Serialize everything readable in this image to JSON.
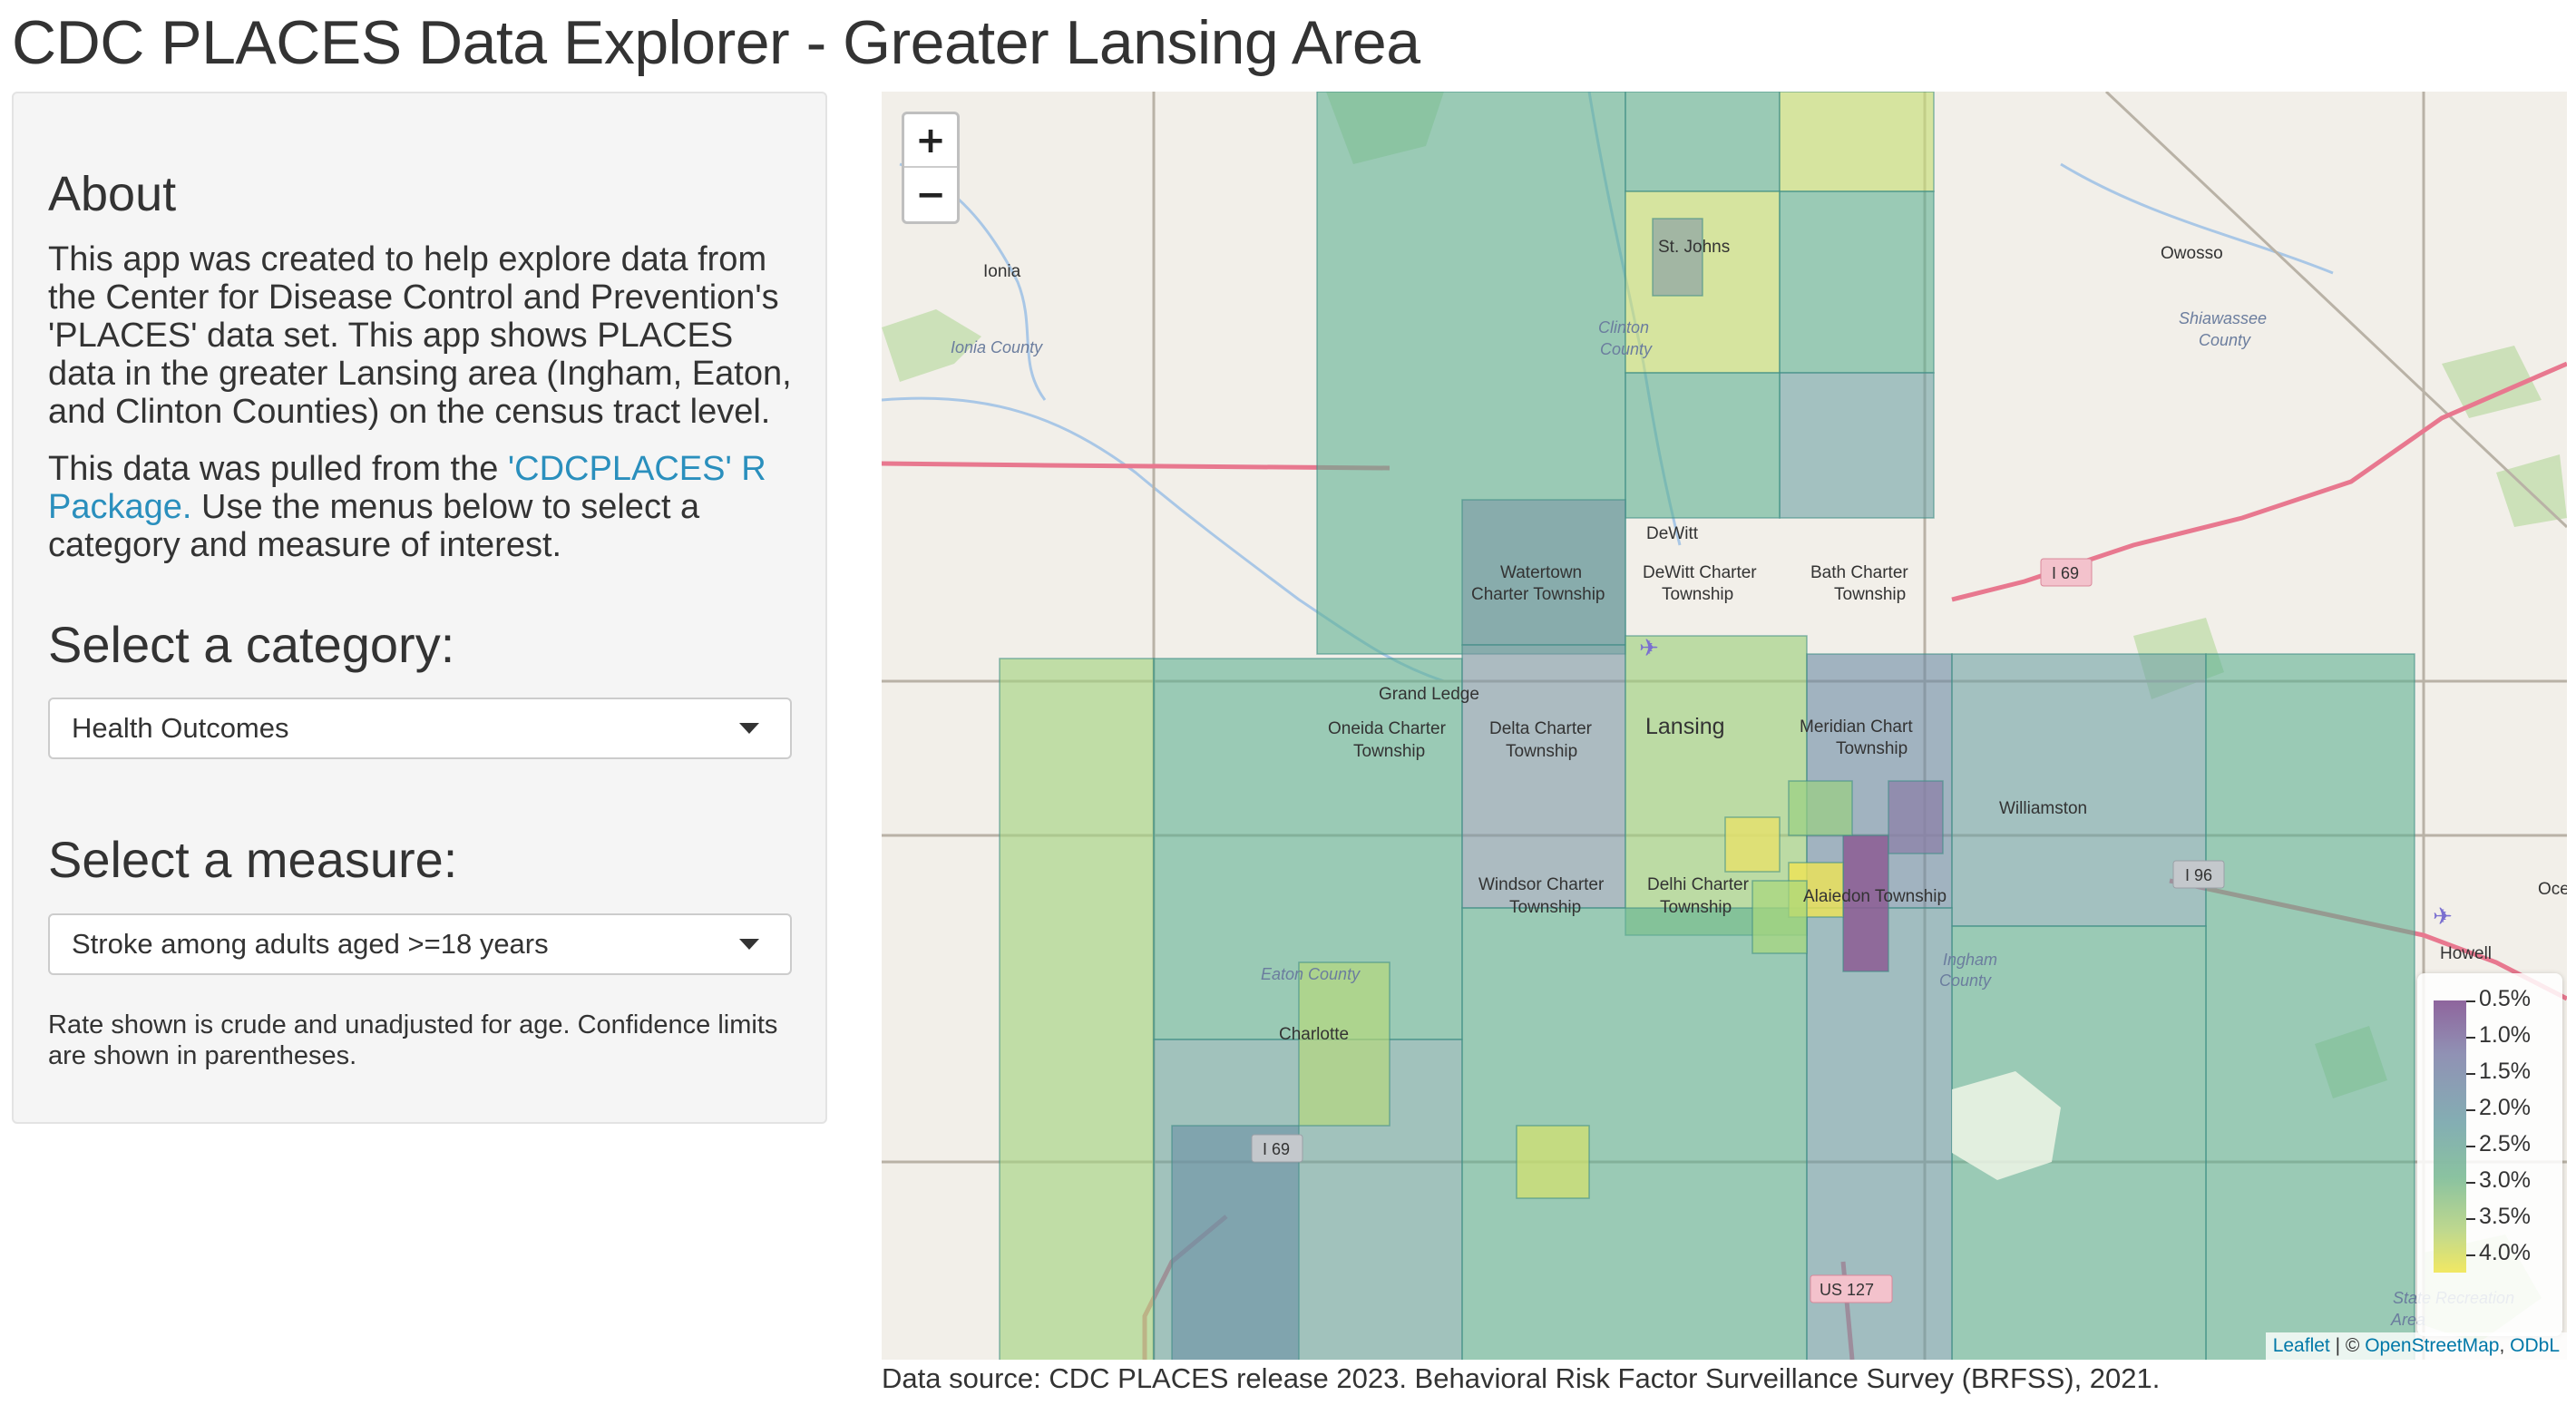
{
  "title": "CDC PLACES Data Explorer - Greater Lansing Area",
  "sidebar": {
    "about_heading": "About",
    "about_text": "This app was created to help explore data from the Center for Disease Control and Prevention's 'PLACES' data set. This app shows PLACES data in the greater Lansing area (Ingham, Eaton, and Clinton Counties) on the census tract level.",
    "pulled_text_before": "This data was pulled from the ",
    "package_link": "'CDCPLACES' R Package.",
    "pulled_text_after": " Use the menus below to select a category and measure of interest.",
    "category_label": "Select a category:",
    "category_value": "Health Outcomes",
    "measure_label": "Select a measure:",
    "measure_value": "Stroke among adults aged >=18 years",
    "note": "Rate shown is crude and unadjusted for age. Confidence limits are shown in parentheses."
  },
  "map": {
    "zoom_in": "+",
    "zoom_out": "−",
    "places": {
      "st_johns": "St. Johns",
      "dewitt": "DeWitt",
      "watertown": "Watertown",
      "watertown2": "Charter Township",
      "dewitt_charter": "DeWitt Charter",
      "dewitt_charter2": "Township",
      "bath": "Bath Charter",
      "bath2": "Township",
      "grand_ledge": "Grand Ledge",
      "lansing": "Lansing",
      "oneida": "Oneida Charter",
      "oneida2": "Township",
      "delta": "Delta Charter",
      "delta2": "Township",
      "meridian": "Meridian Chart",
      "meridian2": "Township",
      "williamston": "Williamston",
      "windsor": "Windsor Charter",
      "windsor2": "Township",
      "delhi": "Delhi Charter",
      "delhi2": "Township",
      "alaiedon": "Alaiedon Township",
      "charlotte": "Charlotte",
      "ionia": "Ionia",
      "owosso": "Owosso",
      "howell": "Howell",
      "oce": "Oce"
    },
    "counties": {
      "ionia": "Ionia County",
      "clinton": "Clinton",
      "clinton2": "County",
      "shiawassee": "Shiawassee",
      "shiawassee2": "County",
      "eaton": "Eaton County",
      "ingham": "Ingham",
      "ingham2": "County",
      "state_rec": "State Recreation",
      "state_rec2": "Area"
    },
    "shields": {
      "i69_ne": "I 69",
      "i96": "I 96",
      "i69_sw": "I 69",
      "us127": "US 127"
    },
    "legend": {
      "labels": [
        "0.5%",
        "1.0%",
        "1.5%",
        "2.0%",
        "2.5%",
        "3.0%",
        "3.5%",
        "4.0%"
      ],
      "colors": {
        "low": "#7b4a8c",
        "high": "#f0e54a"
      }
    },
    "attribution": {
      "leaflet": "Leaflet",
      "sep": " | © ",
      "osm": "OpenStreetMap",
      "comma": ", ",
      "odbl": "ODbL"
    }
  },
  "source": "Data source: CDC PLACES release 2023. Behavioral Risk Factor Surveillance Survey (BRFSS), 2021."
}
